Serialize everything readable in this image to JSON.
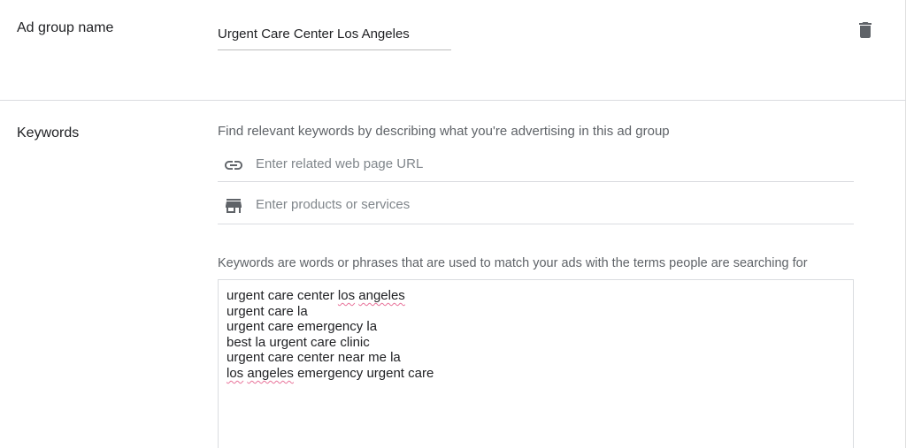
{
  "ad_group": {
    "label": "Ad group name",
    "name_value": "Urgent Care Center Los Angeles",
    "delete_icon": "trash-icon"
  },
  "keywords": {
    "label": "Keywords",
    "hint": "Find relevant keywords by describing what you're advertising in this ad group",
    "url_field": {
      "icon": "link-icon",
      "placeholder": "Enter related web page URL"
    },
    "products_field": {
      "icon": "store-icon",
      "placeholder": "Enter products or services"
    },
    "description": "Keywords are words or phrases that are used to match your ads with the terms people are searching for",
    "list": [
      "urgent care center los angeles",
      "urgent care la",
      "urgent care emergency la",
      "best la urgent care clinic",
      "urgent care center near me la",
      "los angeles emergency urgent care"
    ],
    "spellcheck_flag_color": "#e8739a"
  }
}
